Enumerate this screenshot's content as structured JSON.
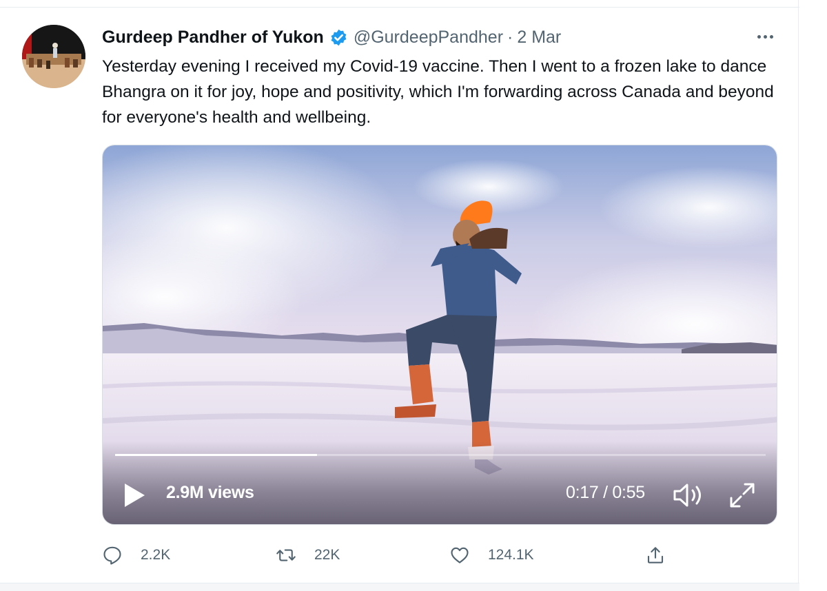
{
  "tweet": {
    "author": {
      "display_name": "Gurdeep Pandher of Yukon",
      "handle": "@GurdeepPandher",
      "verified": true,
      "avatar_icon": "avatar-photo"
    },
    "separator": "·",
    "date": "2 Mar",
    "more_icon": "more-horizontal-icon",
    "text": "Yesterday evening I received my Covid-19 vaccine. Then I went to a frozen lake to dance Bhangra on it for joy, hope and positivity, which I'm forwarding across Canada and beyond for everyone's health and wellbeing."
  },
  "video": {
    "views": "2.9M views",
    "time": "0:17 / 0:55",
    "progress_fraction": 0.31,
    "icons": {
      "play": "play-icon",
      "volume": "volume-icon",
      "fullscreen": "fullscreen-icon"
    }
  },
  "actions": {
    "reply": {
      "icon": "reply-icon",
      "count": "2.2K"
    },
    "retweet": {
      "icon": "retweet-icon",
      "count": "22K"
    },
    "like": {
      "icon": "like-icon",
      "count": "124.1K"
    },
    "share": {
      "icon": "share-icon"
    }
  },
  "colors": {
    "verified_blue": "#1d9bf0",
    "secondary_text": "#536471",
    "primary_text": "#0f1419"
  }
}
